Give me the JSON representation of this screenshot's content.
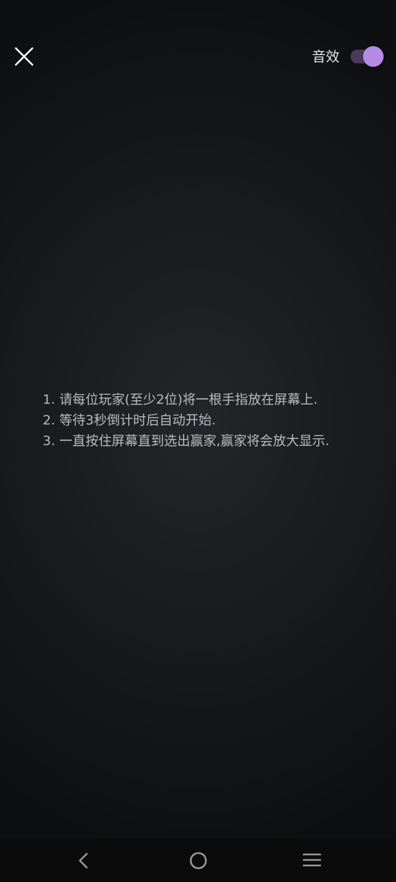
{
  "header": {
    "close_icon": "close-icon",
    "sound_label": "音效",
    "sound_toggle_on": true,
    "toggle_color": "#b78ae6"
  },
  "instructions": [
    "1. 请每位玩家(至少2位)将一根手指放在屏幕上.",
    "2. 等待3秒倒计时后自动开始.",
    "3. 一直按住屏幕直到选出赢家,赢家将会放大显示."
  ],
  "navbar": {
    "back_icon": "back-icon",
    "home_icon": "home-icon",
    "menu_icon": "menu-icon"
  }
}
